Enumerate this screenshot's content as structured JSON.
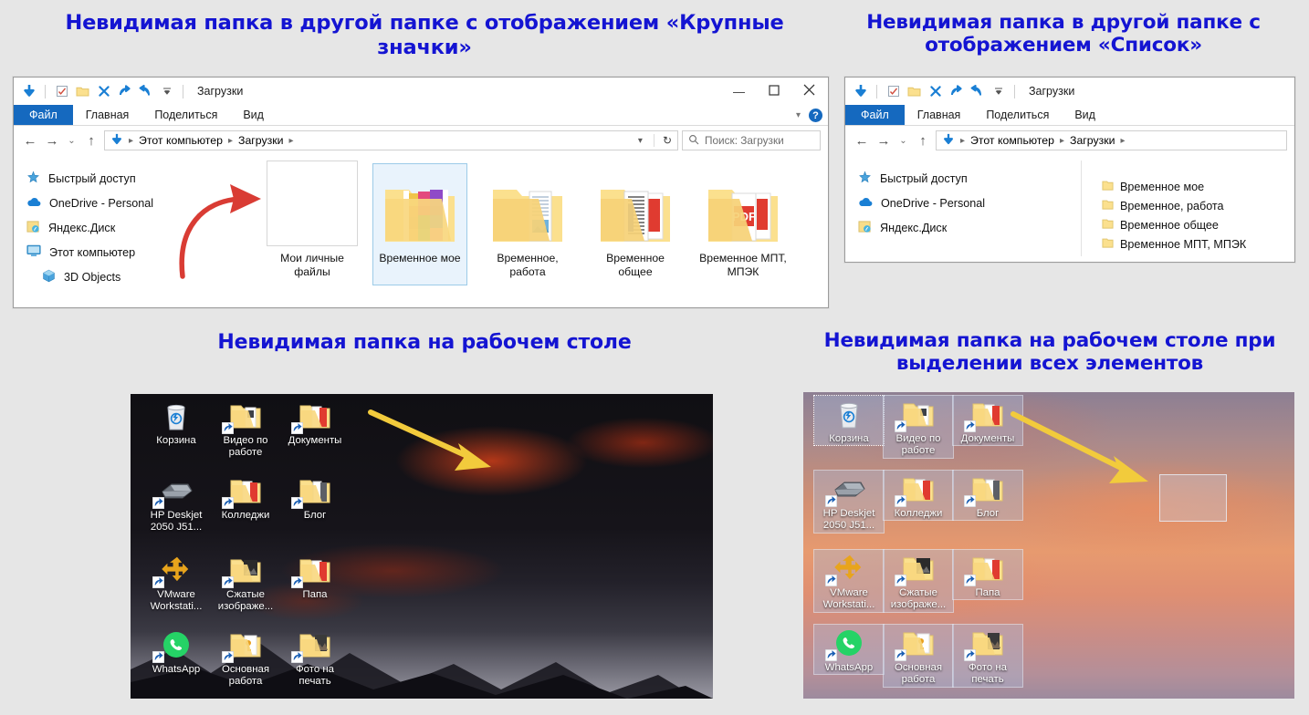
{
  "page": {
    "background_color": "#e6e6e6",
    "heading_color": "#1414d2"
  },
  "headings": {
    "top_left": "Невидимая папка в другой папке с отображением «Крупные значки»",
    "top_right": "Невидимая папка в другой папке с отображением «Список»",
    "bottom_left": "Невидимая папка на рабочем столе",
    "bottom_right": "Невидимая папка на рабочем столе при выделении всех элементов"
  },
  "explorer_large_icons": {
    "window_title": "Загрузки",
    "quick_access_toolbar": {
      "icons": [
        "downloads-arrow-icon",
        "properties-icon",
        "new-folder-icon",
        "delete-icon",
        "redo-icon",
        "undo-icon",
        "customize-chevron-icon"
      ]
    },
    "window_controls": {
      "minimize": "—",
      "maximize": "☐",
      "close": "✕",
      "ribbon_collapse": "⌄",
      "help": "?"
    },
    "ribbon_tabs": [
      "Файл",
      "Главная",
      "Поделиться",
      "Вид"
    ],
    "address_bar": {
      "back": "←",
      "forward": "→",
      "recent": "⌄",
      "up": "↑",
      "breadcrumbs": [
        "Этот компьютер",
        "Загрузки"
      ],
      "refresh": "↻"
    },
    "search": {
      "placeholder": "Поиск: Загрузки",
      "icon": "search-icon"
    },
    "nav_pane": [
      {
        "label": "Быстрый доступ",
        "icon": "star-pin-icon",
        "indent": false
      },
      {
        "label": "OneDrive - Personal",
        "icon": "onedrive-cloud-icon",
        "indent": false
      },
      {
        "label": "Яндекс.Диск",
        "icon": "yandex-disk-icon",
        "indent": false
      },
      {
        "label": "Этот компьютер",
        "icon": "this-pc-icon",
        "indent": false
      },
      {
        "label": "3D Objects",
        "icon": "3d-objects-icon",
        "indent": true
      }
    ],
    "items": [
      {
        "name": "Мои личные файлы",
        "type": "invisible-folder",
        "selected": false
      },
      {
        "name": "Временное мое",
        "type": "folder-pictures",
        "selected": true
      },
      {
        "name": "Временное, работа",
        "type": "folder-mixed",
        "selected": false
      },
      {
        "name": "Временное общее",
        "type": "folder-docs",
        "selected": false
      },
      {
        "name": "Временное МПТ, МПЭК",
        "type": "folder-pdf",
        "selected": false
      }
    ],
    "annotation_arrow_color": "#d93c34"
  },
  "explorer_list_view": {
    "window_title": "Загрузки",
    "ribbon_tabs": [
      "Файл",
      "Главная",
      "Поделиться",
      "Вид"
    ],
    "address_bar": {
      "back": "←",
      "forward": "→",
      "recent": "⌄",
      "up": "↑",
      "breadcrumbs": [
        "Этот компьютер",
        "Загрузки"
      ]
    },
    "nav_pane": [
      {
        "label": "Быстрый доступ",
        "icon": "star-pin-icon"
      },
      {
        "label": "OneDrive - Personal",
        "icon": "onedrive-cloud-icon"
      },
      {
        "label": "Яндекс.Диск",
        "icon": "yandex-disk-icon"
      }
    ],
    "items": [
      {
        "name": "Временное мое",
        "icon": "folder-icon"
      },
      {
        "name": "Временное, работа",
        "icon": "folder-icon"
      },
      {
        "name": "Временное общее",
        "icon": "folder-icon"
      },
      {
        "name": "Временное МПТ, МПЭК",
        "icon": "folder-icon"
      }
    ]
  },
  "desktop_normal": {
    "annotation_arrow_color": "#f2cb3c",
    "icons": [
      {
        "label": "Корзина",
        "glyph": "recycle-bin-icon",
        "col": 0,
        "row": 0,
        "shortcut": false
      },
      {
        "label": "Видео по работе",
        "glyph": "folder-video-icon",
        "col": 1,
        "row": 0,
        "shortcut": true
      },
      {
        "label": "Документы",
        "glyph": "folder-documents-icon",
        "col": 2,
        "row": 0,
        "shortcut": true
      },
      {
        "label": "HP Deskjet 2050 J51...",
        "glyph": "printer-icon",
        "col": 0,
        "row": 1,
        "shortcut": true
      },
      {
        "label": "Колледжи",
        "glyph": "folder-documents-icon",
        "col": 1,
        "row": 1,
        "shortcut": true
      },
      {
        "label": "Блог",
        "glyph": "folder-open-icon",
        "col": 2,
        "row": 1,
        "shortcut": true
      },
      {
        "label": "VMware Workstati...",
        "glyph": "vmware-icon",
        "col": 0,
        "row": 2,
        "shortcut": true
      },
      {
        "label": "Сжатые изображе...",
        "glyph": "folder-images-icon",
        "col": 1,
        "row": 2,
        "shortcut": true
      },
      {
        "label": "Папа",
        "glyph": "folder-documents-icon",
        "col": 2,
        "row": 2,
        "shortcut": true
      },
      {
        "label": "WhatsApp",
        "glyph": "whatsapp-icon",
        "col": 0,
        "row": 3,
        "shortcut": true
      },
      {
        "label": "Основная работа",
        "glyph": "folder-key-icon",
        "col": 1,
        "row": 3,
        "shortcut": true
      },
      {
        "label": "Фото на печать",
        "glyph": "folder-photos-icon",
        "col": 2,
        "row": 3,
        "shortcut": true
      }
    ]
  },
  "desktop_selected": {
    "annotation_arrow_color": "#f2cb3c",
    "invisible_folder_visible": true,
    "icons": [
      {
        "label": "Корзина",
        "glyph": "recycle-bin-icon",
        "col": 0,
        "row": 0,
        "shortcut": false,
        "focused": true
      },
      {
        "label": "Видео по работе",
        "glyph": "folder-video-icon",
        "col": 1,
        "row": 0,
        "shortcut": true
      },
      {
        "label": "Документы",
        "glyph": "folder-documents-icon",
        "col": 2,
        "row": 0,
        "shortcut": true
      },
      {
        "label": "HP Deskjet 2050 J51...",
        "glyph": "printer-icon",
        "col": 0,
        "row": 1,
        "shortcut": true
      },
      {
        "label": "Колледжи",
        "glyph": "folder-documents-icon",
        "col": 1,
        "row": 1,
        "shortcut": true
      },
      {
        "label": "Блог",
        "glyph": "folder-open-icon",
        "col": 2,
        "row": 1,
        "shortcut": true
      },
      {
        "label": "VMware Workstati...",
        "glyph": "vmware-icon",
        "col": 0,
        "row": 2,
        "shortcut": true
      },
      {
        "label": "Сжатые изображе...",
        "glyph": "folder-images-icon",
        "col": 1,
        "row": 2,
        "shortcut": true
      },
      {
        "label": "Папа",
        "glyph": "folder-documents-icon",
        "col": 2,
        "row": 2,
        "shortcut": true
      },
      {
        "label": "WhatsApp",
        "glyph": "whatsapp-icon",
        "col": 0,
        "row": 3,
        "shortcut": true
      },
      {
        "label": "Основная работа",
        "glyph": "folder-key-icon",
        "col": 1,
        "row": 3,
        "shortcut": true
      },
      {
        "label": "Фото на печать",
        "glyph": "folder-photos-icon",
        "col": 2,
        "row": 3,
        "shortcut": true
      }
    ]
  }
}
